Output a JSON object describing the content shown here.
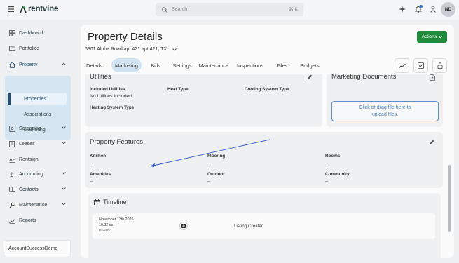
{
  "header": {
    "brand": "rentvine",
    "search_placeholder": "Search",
    "search_shortcut": "⌘ K",
    "avatar_initials": "ND"
  },
  "sidebar": {
    "items": [
      {
        "label": "Dashboard",
        "icon": "dashboard-icon"
      },
      {
        "label": "Portfolios",
        "icon": "folder-icon"
      },
      {
        "label": "Property",
        "icon": "house-icon"
      },
      {
        "label": "Screening",
        "icon": "screening-icon"
      },
      {
        "label": "Leases",
        "icon": "document-icon"
      },
      {
        "label": "Rentsign",
        "icon": "signature-icon"
      },
      {
        "label": "Accounting",
        "icon": "dollar-icon"
      },
      {
        "label": "Contacts",
        "icon": "contacts-icon"
      },
      {
        "label": "Maintenance",
        "icon": "wrench-icon"
      },
      {
        "label": "Reports",
        "icon": "chart-icon"
      }
    ],
    "property_sub": [
      "Properties",
      "Associations",
      "Marketing"
    ],
    "account_name": "AccountSuccessDemo"
  },
  "page": {
    "title": "Property Details",
    "actions_label": "Actions",
    "address": "5301 Alpha Road apt 421 apt 421, TX",
    "tabs": [
      "Details",
      "Marketing",
      "Bills",
      "Settings",
      "Maintenance",
      "Inspections",
      "Files",
      "Budgets"
    ],
    "active_tab": "Marketing"
  },
  "utilities": {
    "title": "Utilities",
    "included_label": "Included Utilities",
    "included_value": "No Utilities Included",
    "heat_label": "Heat Type",
    "cooling_label": "Cooling System Type",
    "heating_label": "Heating System Type"
  },
  "marketing_docs": {
    "title": "Marketing Documents",
    "upload_line1": "Click or drag file here to",
    "upload_line2": "upload files."
  },
  "features": {
    "title": "Property Features",
    "kitchen_label": "Kitchen",
    "kitchen_value": "--",
    "flooring_label": "Flooring",
    "flooring_value": "--",
    "rooms_label": "Rooms",
    "rooms_value": "--",
    "amenities_label": "Amenities",
    "amenities_value": "--",
    "outdoor_label": "Outdoor",
    "outdoor_value": "--",
    "community_label": "Community",
    "community_value": "--"
  },
  "timeline": {
    "title": "Timeline",
    "date": "November 13th 2025",
    "time": "10:32 am",
    "user": "David Do",
    "event": "Listing Created"
  },
  "colors": {
    "accent_green": "#1e8a3a",
    "nav_highlight": "#d5e6f2",
    "brand_dark": "#1f4e79",
    "annotation_arrow": "#2a4fc4"
  }
}
